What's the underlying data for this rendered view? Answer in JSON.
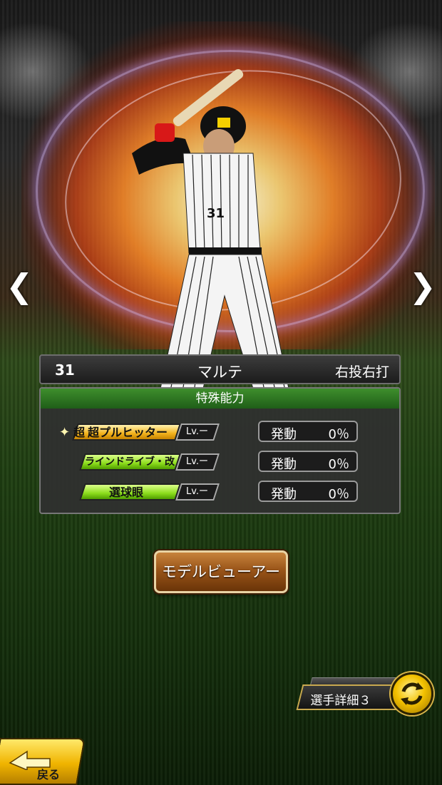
{
  "player": {
    "number": "31",
    "name": "マルテ",
    "handedness": "右投右打"
  },
  "abilities": {
    "header": "特殊能力",
    "items": [
      {
        "prefix": "超",
        "name": "超プルヒッター",
        "level": "Lv.ー",
        "trigger_label": "発動",
        "trigger_value": "0％",
        "style": "gold"
      },
      {
        "name": "ラインドライブ・改",
        "level": "Lv.ー",
        "trigger_label": "発動",
        "trigger_value": "0％",
        "style": "green"
      },
      {
        "name": "選球眼",
        "level": "Lv.ー",
        "trigger_label": "発動",
        "trigger_value": "0％",
        "style": "green"
      }
    ]
  },
  "buttons": {
    "model_viewer": "モデルビューアー",
    "player_detail": "選手詳細３",
    "back": "戻る"
  },
  "nav": {
    "prev_icon": "chevron-left-icon",
    "next_icon": "chevron-right-icon"
  },
  "colors": {
    "ability_header": "#2f7a22",
    "gold_tag": "#f2b21c",
    "green_tag": "#8bdc1b",
    "model_button": "#9a5519"
  }
}
